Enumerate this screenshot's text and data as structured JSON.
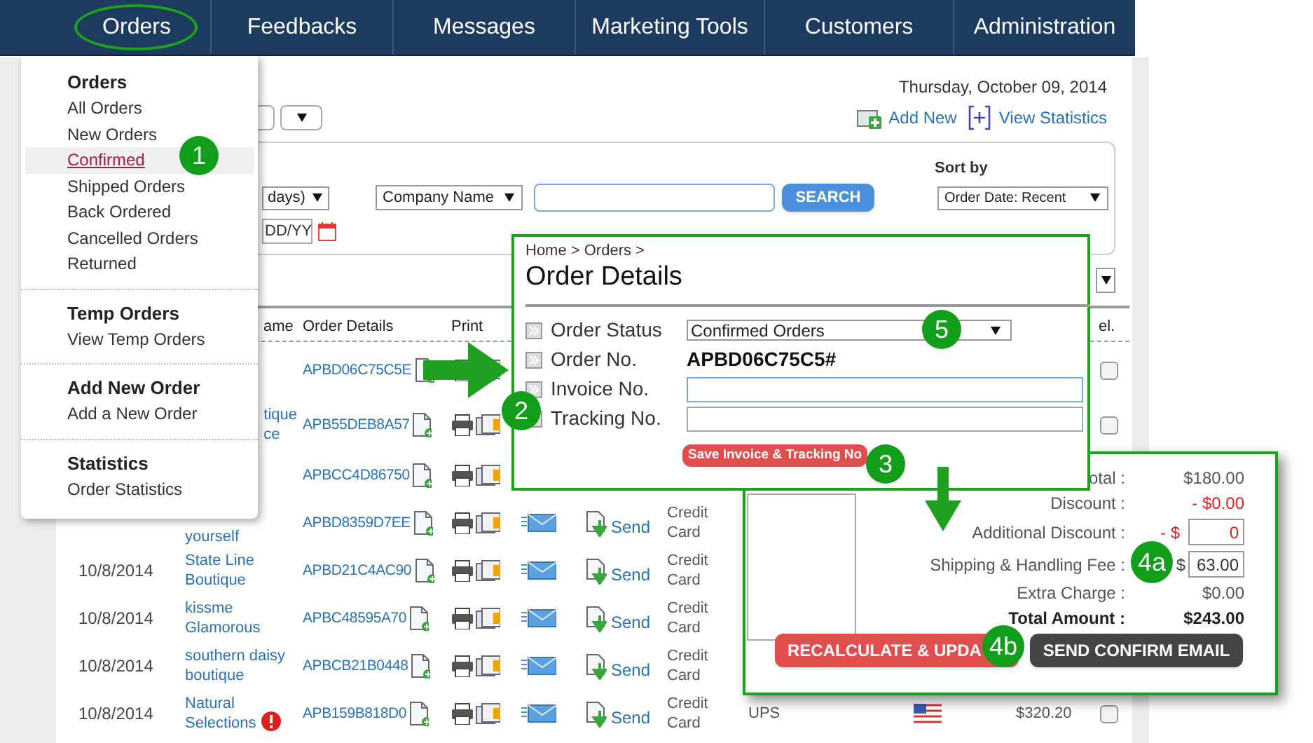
{
  "nav": [
    {
      "label": "Orders",
      "circled": true
    },
    {
      "label": "Feedbacks",
      "circled": false
    },
    {
      "label": "Messages",
      "circled": false
    },
    {
      "label": "Marketing Tools",
      "circled": false
    },
    {
      "label": "Customers",
      "circled": false
    },
    {
      "label": "Administration",
      "circled": false
    }
  ],
  "date": "Thursday, October 09, 2014",
  "toolbar": {
    "add_new": "Add New",
    "view_statistics": "View Statistics"
  },
  "filters": {
    "days_select": "days)",
    "field_select": "Company Name",
    "search_button": "SEARCH",
    "sort_label": "Sort by",
    "sort_select": "Order Date: Recent",
    "date_field": "DD/YY"
  },
  "table": {
    "columns": [
      "ame",
      "Order Details",
      "Print",
      "el."
    ],
    "rows": [
      {
        "order_id": "APBD06C75C5E",
        "checked": false
      },
      {
        "company": "tique\nce",
        "order_id": "APB55DEB8A57",
        "checked": false
      },
      {
        "order_id": "APBCC4D86750"
      },
      {
        "company": "yourself",
        "order_id": "APBD8359D7EE",
        "send": "Send",
        "payment": "Credit\nCard"
      },
      {
        "date": "10/8/2014",
        "company": "State Line\nBoutique",
        "order_id": "APBD21C4AC90",
        "send": "Send",
        "payment": "Credit\nCard"
      },
      {
        "date": "10/8/2014",
        "company": "kissme\nGlamorous",
        "order_id": "APBC48595A70",
        "send": "Send",
        "payment": "Credit\nCard"
      },
      {
        "date": "10/8/2014",
        "company": "southern daisy\nboutique",
        "order_id": "APBCB21B0448",
        "send": "Send",
        "payment": "Credit\nCard"
      },
      {
        "date": "10/8/2014",
        "company": "Natural\nSelections",
        "alert": true,
        "order_id": "APB159B818D0",
        "send": "Send",
        "payment": "Credit\nCard",
        "shipping": "UPS",
        "amount": "$320.20",
        "checked": false
      }
    ]
  },
  "menu": {
    "sections": [
      {
        "title": "Orders",
        "items": [
          {
            "label": "All Orders",
            "selected": false
          },
          {
            "label": "New Orders",
            "selected": false
          },
          {
            "label": "Confirmed",
            "selected": true
          },
          {
            "label": "Shipped Orders",
            "selected": false
          },
          {
            "label": "Back Ordered",
            "selected": false
          },
          {
            "label": "Cancelled Orders",
            "selected": false
          },
          {
            "label": "Returned",
            "selected": false
          }
        ]
      },
      {
        "title": "Temp Orders",
        "items": [
          {
            "label": "View Temp Orders",
            "selected": false
          }
        ]
      },
      {
        "title": "Add New Order",
        "items": [
          {
            "label": "Add a New Order",
            "selected": false
          }
        ]
      },
      {
        "title": "Statistics",
        "items": [
          {
            "label": "Order Statistics",
            "selected": false
          }
        ]
      }
    ]
  },
  "order_details": {
    "breadcrumb": "Home > Orders >",
    "title": "Order Details",
    "fields": [
      {
        "label": "Order Status",
        "kind": "select",
        "value": "Confirmed Orders"
      },
      {
        "label": "Order No.",
        "kind": "text",
        "value": "APBD06C75C5#"
      },
      {
        "label": "Invoice No.",
        "kind": "input",
        "focused": true
      },
      {
        "label": "Tracking No.",
        "kind": "input",
        "focused": false
      }
    ],
    "save_button": "Save Invoice & Tracking No"
  },
  "totals": {
    "lines": [
      {
        "label": "otal :",
        "kind": "plain",
        "value": "$180.00"
      },
      {
        "label": "Discount :",
        "kind": "negative",
        "value": "- $0.00"
      },
      {
        "label": "Additional Discount :",
        "kind": "negative_input",
        "prefix": "- $",
        "value": "0"
      },
      {
        "label": "Shipping & Handling Fee :",
        "kind": "input",
        "prefix": "$",
        "value": "63.00"
      },
      {
        "label": "Extra Charge :",
        "kind": "plain",
        "value": "$0.00"
      },
      {
        "label": "Total Amount :",
        "kind": "total",
        "value": "$243.00"
      }
    ],
    "recalculate_button": "RECALCULATE & UPDA",
    "email_button": "SEND CONFIRM EMAIL"
  },
  "callouts": [
    "1",
    "2",
    "3",
    "5",
    "4a",
    "4b"
  ]
}
